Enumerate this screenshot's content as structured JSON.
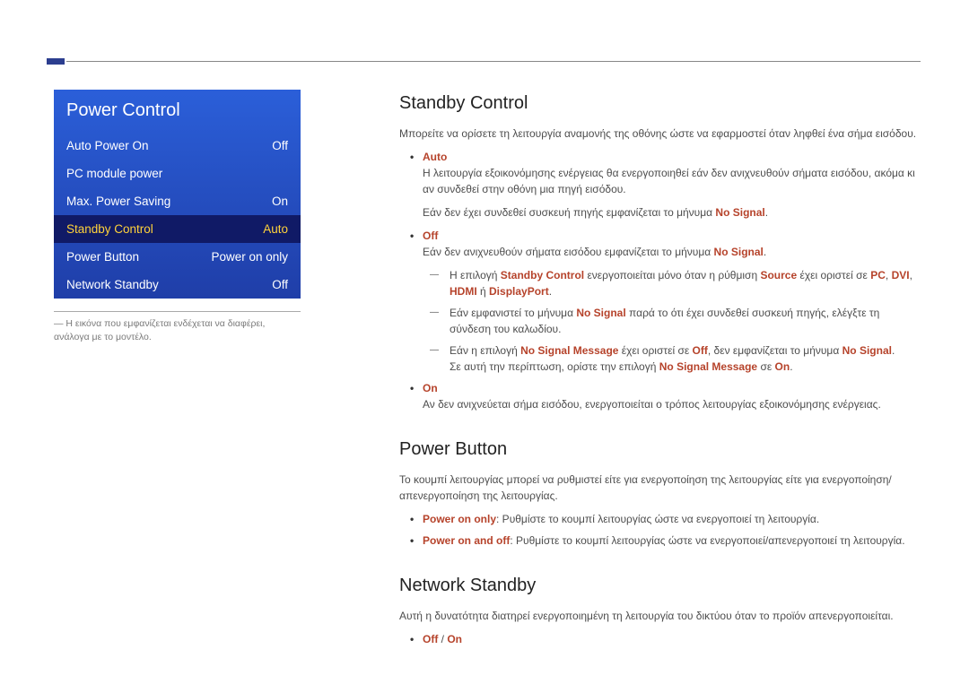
{
  "menu": {
    "title": "Power Control",
    "items": [
      {
        "label": "Auto Power On",
        "value": "Off",
        "selected": false
      },
      {
        "label": "PC module power",
        "value": "",
        "selected": false
      },
      {
        "label": "Max. Power Saving",
        "value": "On",
        "selected": false
      },
      {
        "label": "Standby Control",
        "value": "Auto",
        "selected": true
      },
      {
        "label": "Power Button",
        "value": "Power on only",
        "selected": false
      },
      {
        "label": "Network Standby",
        "value": "Off",
        "selected": false
      }
    ]
  },
  "caption_dash": "―",
  "caption": "Η εικόνα που εμφανίζεται ενδέχεται να διαφέρει, ανάλογα με το μοντέλο.",
  "sections": {
    "standby": {
      "heading": "Standby Control",
      "intro": "Μπορείτε να ορίσετε τη λειτουργία αναμονής της οθόνης ώστε να εφαρμοστεί όταν ληφθεί ένα σήμα εισόδου.",
      "auto": {
        "label": "Auto",
        "p1": "Η λειτουργία εξοικονόμησης ενέργειας θα ενεργοποιηθεί εάν δεν ανιχνευθούν σήματα εισόδου, ακόμα κι αν συνδεθεί στην οθόνη μια πηγή εισόδου.",
        "p2_a": "Εάν δεν έχει συνδεθεί συσκευή πηγής εμφανίζεται το μήνυμα ",
        "p2_b": "No Signal",
        "p2_c": "."
      },
      "off": {
        "label": "Off",
        "p1_a": "Εάν δεν ανιχνευθούν σήματα εισόδου εμφανίζεται το μήνυμα ",
        "p1_b": "No Signal",
        "p1_c": ".",
        "n1_a": "Η επιλογή ",
        "n1_b": "Standby Control",
        "n1_c": " ενεργοποιείται μόνο όταν η ρύθμιση ",
        "n1_d": "Source",
        "n1_e": " έχει οριστεί σε ",
        "n1_f": "PC",
        "n1_g": ", ",
        "n1_h": "DVI",
        "n1_i": ", ",
        "n1_j": "HDMI",
        "n1_k": " ή ",
        "n1_l": "DisplayPort",
        "n1_m": ".",
        "n2_a": "Εάν εμφανιστεί το μήνυμα ",
        "n2_b": "No Signal",
        "n2_c": " παρά το ότι έχει συνδεθεί συσκευή πηγής, ελέγξτε τη σύνδεση του καλωδίου.",
        "n3_a": "Εάν η επιλογή ",
        "n3_b": "No Signal Message",
        "n3_c": " έχει οριστεί σε ",
        "n3_d": "Off",
        "n3_e": ", δεν εμφανίζεται το μήνυμα ",
        "n3_f": "No Signal",
        "n3_g": ".",
        "n3_x": "Σε αυτή την περίπτωση, ορίστε την επιλογή ",
        "n3_y": "No Signal Message",
        "n3_z1": " σε ",
        "n3_z2": "On",
        "n3_z3": "."
      },
      "on": {
        "label": "On",
        "p1": "Αν δεν ανιχνεύεται σήμα εισόδου, ενεργοποιείται ο τρόπος λειτουργίας εξοικονόμησης ενέργειας."
      }
    },
    "power_button": {
      "heading": "Power Button",
      "intro": "Το κουμπί λειτουργίας μπορεί να ρυθμιστεί είτε για ενεργοποίηση της λειτουργίας είτε για ενεργοποίηση/απενεργοποίηση της λειτουργίας.",
      "b1_a": "Power on only",
      "b1_b": ": Ρυθμίστε το κουμπί λειτουργίας ώστε να ενεργοποιεί τη λειτουργία.",
      "b2_a": "Power on and off",
      "b2_b": ": Ρυθμίστε το κουμπί λειτουργίας ώστε να ενεργοποιεί/απενεργοποιεί τη λειτουργία."
    },
    "network_standby": {
      "heading": "Network Standby",
      "intro": "Αυτή η δυνατότητα διατηρεί ενεργοποιημένη τη λειτουργία του δικτύου όταν το προϊόν απενεργοποιείται.",
      "opt_off": "Off",
      "opt_sep": " / ",
      "opt_on": "On"
    }
  }
}
